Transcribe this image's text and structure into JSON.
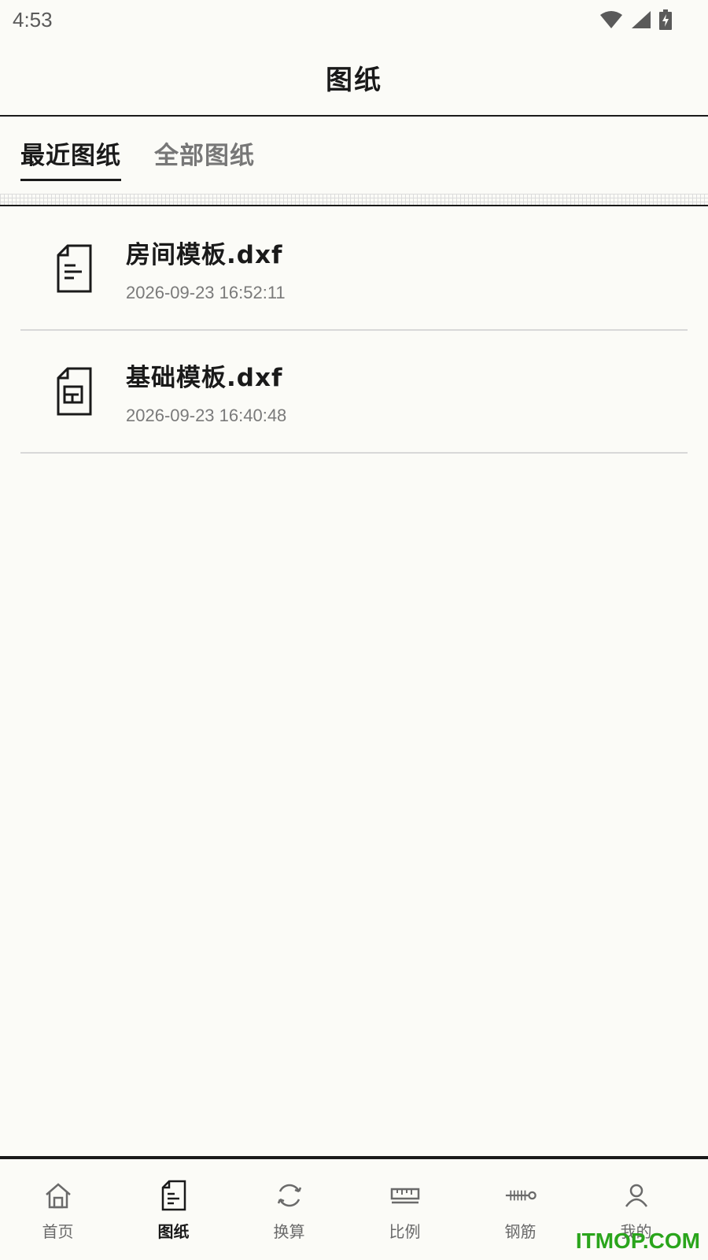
{
  "status_bar": {
    "time": "4:53"
  },
  "header": {
    "title": "图纸"
  },
  "tabs": [
    {
      "label": "最近图纸",
      "active": true
    },
    {
      "label": "全部图纸",
      "active": false
    }
  ],
  "files": [
    {
      "name": "房间模板.dxf",
      "date": "2026-09-23 16:52:11",
      "icon": "document-icon"
    },
    {
      "name": "基础模板.dxf",
      "date": "2026-09-23 16:40:48",
      "icon": "blueprint-document-icon"
    }
  ],
  "bottom_nav": [
    {
      "label": "首页",
      "icon": "home-icon",
      "active": false
    },
    {
      "label": "图纸",
      "icon": "drawing-icon",
      "active": true
    },
    {
      "label": "换算",
      "icon": "convert-icon",
      "active": false
    },
    {
      "label": "比例",
      "icon": "ruler-icon",
      "active": false
    },
    {
      "label": "钢筋",
      "icon": "rebar-icon",
      "active": false
    },
    {
      "label": "我的",
      "icon": "person-icon",
      "active": false
    }
  ],
  "watermark": "ITMOP.COM",
  "colors": {
    "background": "#fbfbf7",
    "text": "#1a1a1a",
    "watermark": "#2aa51c"
  }
}
